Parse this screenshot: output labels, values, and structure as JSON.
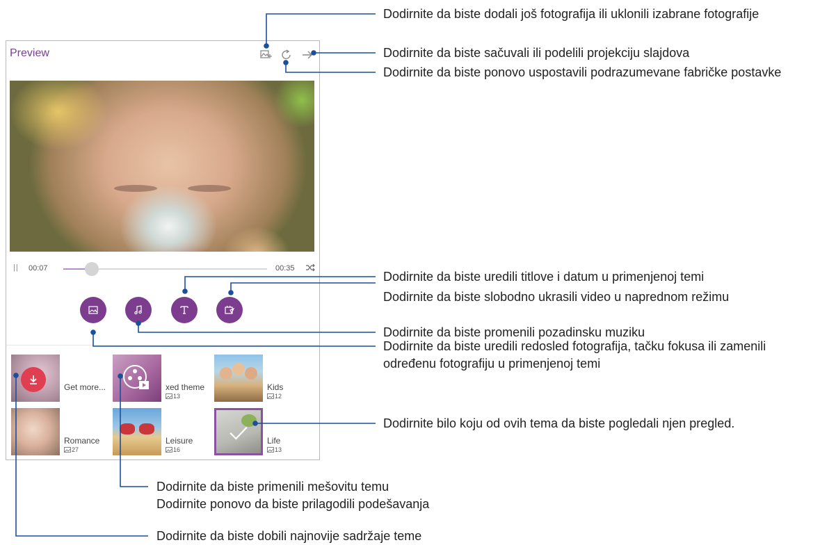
{
  "screen": {
    "title": "Preview",
    "toolbar": {
      "add_photos_icon": "add-photo-icon",
      "reset_icon": "refresh-icon",
      "next_icon": "arrow-right-icon"
    },
    "player": {
      "pause_symbol": "||",
      "current_time": "00:07",
      "total_time": "00:35",
      "progress": 0.14,
      "shuffle_icon": "shuffle-icon"
    },
    "actions": [
      {
        "name": "photo-order-button",
        "icon": "image-icon"
      },
      {
        "name": "music-button",
        "icon": "music-note-icon"
      },
      {
        "name": "title-button",
        "icon": "text-title-icon"
      },
      {
        "name": "advanced-edit-button",
        "icon": "advanced-edit-icon"
      }
    ],
    "themes": [
      {
        "name": "Get more...",
        "count": ""
      },
      {
        "name": "xed theme",
        "count": "13"
      },
      {
        "name": "Kids",
        "count": "12"
      },
      {
        "name": "Romance",
        "count": "27"
      },
      {
        "name": "Leisure",
        "count": "16"
      },
      {
        "name": "Life",
        "count": "13"
      }
    ]
  },
  "annotations": {
    "add_photos": "Dodirnite da biste dodali još fotografija ili uklonili izabrane fotografije",
    "save_share": "Dodirnite da biste sačuvali ili podelili projekciju slajdova",
    "reset": "Dodirnite da biste ponovo uspostavili podrazumevane fabričke postavke",
    "edit_titles": "Dodirnite da biste uredili titlove i datum u primenjenoj temi",
    "advanced": "Dodirnite da biste slobodno ukrasili video u naprednom režimu",
    "music": "Dodirnite da biste promenili pozadinsku muziku",
    "photo_order": "Dodirnite da biste uredili redosled fotografija, tačku fokusa ili zamenili određenu fotografiju u primenjenoj temi",
    "themes": "Dodirnite bilo koju od ovih tema da biste pogledali njen pregled.",
    "mixed_line1": "Dodirnite da biste primenili mešovitu temu",
    "mixed_line2": "Dodirnite ponovo da biste prilagodili podešavanja",
    "get_more": "Dodirnite da biste dobili najnovije sadržaje teme"
  },
  "colors": {
    "accent": "#7c3d8f",
    "annotation_line": "#1b4f9c"
  }
}
